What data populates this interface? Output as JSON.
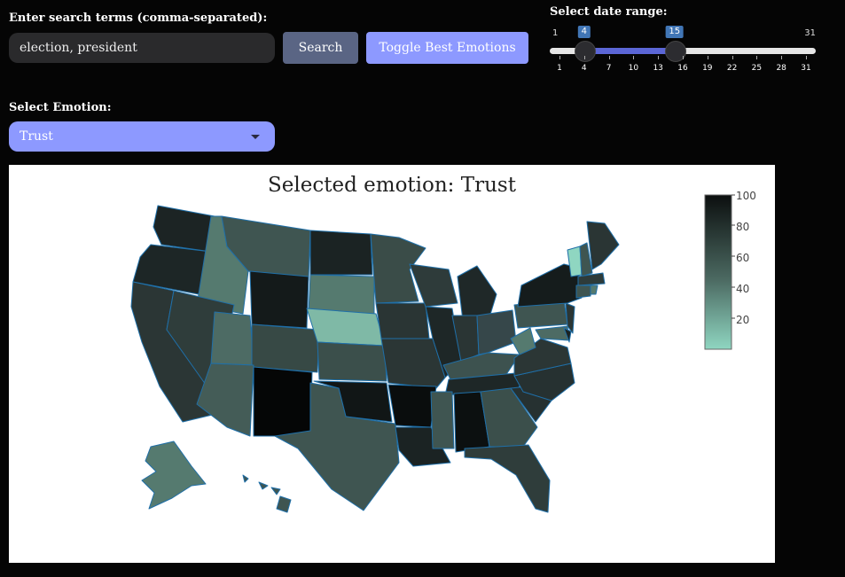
{
  "search": {
    "label": "Enter search terms (comma-separated):",
    "value": "election, president",
    "button_label": "Search",
    "toggle_label": "Toggle Best Emotions"
  },
  "emotion": {
    "label": "Select Emotion:",
    "selected": "Trust"
  },
  "date_range": {
    "label": "Select date range:",
    "min": 1,
    "max": 31,
    "start": 4,
    "end": 15,
    "min_label": "1",
    "max_label": "31",
    "start_label": "4",
    "end_label": "15",
    "ticks": [
      "1",
      "4",
      "7",
      "10",
      "13",
      "16",
      "19",
      "22",
      "25",
      "28",
      "31"
    ]
  },
  "map": {
    "title": "Selected emotion:  Trust",
    "colorbar_ticks": [
      "100",
      "80",
      "60",
      "40",
      "20"
    ],
    "colorbar_range": [
      0,
      100
    ],
    "colors": {
      "low": "#8fd6c1",
      "mid": "#4c6a62",
      "high": "#0c0f0f"
    }
  }
}
